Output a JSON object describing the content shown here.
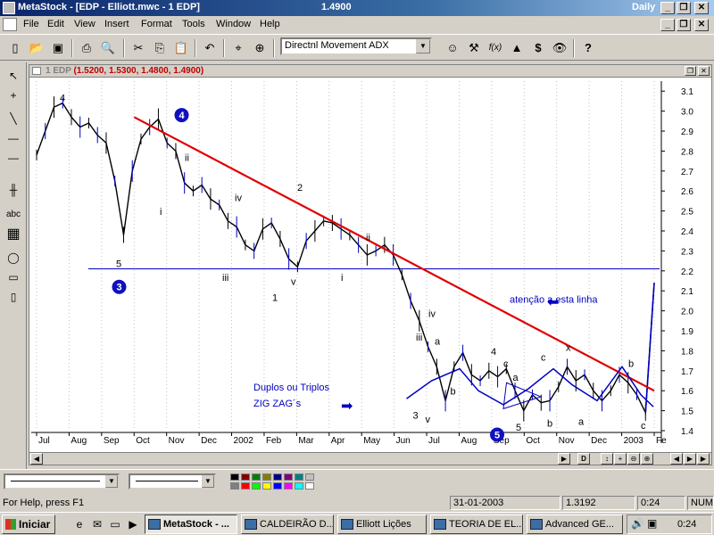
{
  "app": {
    "title": "MetaStock - [EDP - Elliott.mwc - 1 EDP]",
    "price": "1.4900",
    "period": "Daily",
    "minimize": "_",
    "restore": "❐",
    "close": "✕"
  },
  "menu": [
    "File",
    "Edit",
    "View",
    "Insert",
    "Format",
    "Tools",
    "Window",
    "Help"
  ],
  "toolbar": {
    "indicator_select": "Directnl Movement ADX",
    "buttons": [
      {
        "icon": "new-icon",
        "glyph": "▯"
      },
      {
        "icon": "open-icon",
        "glyph": "📂"
      },
      {
        "icon": "save-icon",
        "glyph": "▣"
      },
      {
        "icon": "print-icon",
        "glyph": "⎙"
      },
      {
        "icon": "print-preview-icon",
        "glyph": "🔍"
      },
      {
        "icon": "cut-icon",
        "glyph": "✂"
      },
      {
        "icon": "copy-icon",
        "glyph": "⎘"
      },
      {
        "icon": "paste-icon",
        "glyph": "📋"
      },
      {
        "icon": "undo-icon",
        "glyph": "↶"
      },
      {
        "icon": "crosshair-icon",
        "glyph": "⌖"
      },
      {
        "icon": "zoom-icon",
        "glyph": "⊕"
      }
    ],
    "right_buttons": [
      {
        "icon": "expert-advisor-icon",
        "glyph": "☺"
      },
      {
        "icon": "explorer-icon",
        "glyph": "⚒"
      },
      {
        "icon": "formula-icon",
        "glyph": "f(x)"
      },
      {
        "icon": "system-tester-icon",
        "glyph": "▲"
      },
      {
        "icon": "dollar-icon",
        "glyph": "$"
      },
      {
        "icon": "binoculars-icon",
        "glyph": "👁"
      },
      {
        "icon": "help-icon",
        "glyph": "?"
      }
    ]
  },
  "left_tools": [
    {
      "icon": "pointer-icon",
      "glyph": "↖"
    },
    {
      "icon": "crosshair-tool-icon",
      "glyph": "+"
    },
    {
      "icon": "trendline-icon",
      "glyph": "╲"
    },
    {
      "icon": "horizontal-line-icon",
      "glyph": "—"
    },
    {
      "icon": "horizontal-line-2-icon",
      "glyph": "—"
    },
    {
      "icon": "vertical-line-icon",
      "glyph": "│"
    },
    {
      "icon": "cycle-lines-icon",
      "glyph": "╫"
    },
    {
      "icon": "text-tool-icon",
      "glyph": "abc"
    },
    {
      "icon": "grid-tool-icon",
      "glyph": "▦"
    },
    {
      "icon": "ellipse-icon",
      "glyph": "◯"
    },
    {
      "icon": "rectangle-icon",
      "glyph": "▭"
    },
    {
      "icon": "channel-icon",
      "glyph": "▯"
    }
  ],
  "chart_caption": {
    "symbol": "1 EDP",
    "ohlc": "(1.5200, 1.5300, 1.4800, 1.4900)"
  },
  "chart_data": {
    "type": "line",
    "title": "1 EDP",
    "ylim": [
      1.4,
      3.15
    ],
    "y_ticks": [
      "3.1",
      "3.0",
      "2.9",
      "2.8",
      "2.7",
      "2.6",
      "2.5",
      "2.4",
      "2.3",
      "2.2",
      "2.1",
      "2.0",
      "1.9",
      "1.8",
      "1.7",
      "1.6",
      "1.5",
      "1.4"
    ],
    "x_ticks": [
      "Jul",
      "Aug",
      "Sep",
      "Oct",
      "Nov",
      "Dec",
      "2002",
      "Feb",
      "Mar",
      "Apr",
      "May",
      "Jun",
      "Jul",
      "Aug",
      "Sep",
      "Oct",
      "Nov",
      "Dec",
      "2003",
      "Fe"
    ],
    "series": [
      {
        "values": [
          2.78,
          2.9,
          3.02,
          3.04,
          2.97,
          2.92,
          2.94,
          2.88,
          2.84,
          2.65,
          2.38,
          2.7,
          2.86,
          2.92,
          2.96,
          2.84,
          2.8,
          2.64,
          2.6,
          2.63,
          2.56,
          2.53,
          2.45,
          2.42,
          2.33,
          2.3,
          2.41,
          2.44,
          2.36,
          2.26,
          2.22,
          2.35,
          2.4,
          2.45,
          2.44,
          2.41,
          2.38,
          2.33,
          2.28,
          2.3,
          2.33,
          2.28,
          2.18,
          2.05,
          1.95,
          1.82,
          1.72,
          1.55,
          1.72,
          1.79,
          1.68,
          1.65,
          1.7,
          1.67,
          1.71,
          1.6,
          1.5,
          1.58,
          1.54,
          1.55,
          1.62,
          1.72,
          1.65,
          1.68,
          1.6,
          1.55,
          1.6,
          1.68,
          1.64,
          1.58,
          1.49,
          2.14
        ]
      }
    ],
    "horizontal_line": 2.21,
    "trendline": {
      "from": [
        "Oct",
        2.97
      ],
      "to": [
        "Feb",
        1.6
      ]
    },
    "annotations": [
      {
        "text": "4",
        "kind": "wave"
      },
      {
        "text": "5",
        "kind": "wave"
      },
      {
        "text": "ii",
        "kind": "wave"
      },
      {
        "text": "i",
        "kind": "wave"
      },
      {
        "text": "iv",
        "kind": "wave"
      },
      {
        "text": "2",
        "kind": "wave"
      },
      {
        "text": "iii",
        "kind": "wave"
      },
      {
        "text": "v",
        "kind": "wave"
      },
      {
        "text": "1",
        "kind": "wave"
      },
      {
        "text": "i",
        "kind": "wave"
      },
      {
        "text": "ii",
        "kind": "wave"
      },
      {
        "text": "iv",
        "kind": "wave"
      },
      {
        "text": "iii",
        "kind": "wave"
      },
      {
        "text": "3",
        "kind": "wave"
      },
      {
        "text": "v",
        "kind": "wave"
      },
      {
        "text": "a",
        "kind": "wave"
      },
      {
        "text": "b",
        "kind": "wave"
      },
      {
        "text": "4",
        "kind": "wave"
      },
      {
        "text": "c",
        "kind": "wave"
      },
      {
        "text": "a",
        "kind": "wave"
      },
      {
        "text": "5",
        "kind": "wave"
      },
      {
        "text": "c",
        "kind": "wave"
      },
      {
        "text": "b",
        "kind": "wave"
      },
      {
        "text": "x",
        "kind": "wave"
      },
      {
        "text": "a",
        "kind": "wave"
      },
      {
        "text": "b",
        "kind": "wave"
      },
      {
        "text": "c",
        "kind": "wave"
      },
      {
        "text": "atenção a esta linha",
        "kind": "note"
      },
      {
        "text": "Duplos ou Triplos",
        "kind": "note"
      },
      {
        "text": "ZIG ZAG´s",
        "kind": "note"
      }
    ],
    "circled": [
      "4",
      "3",
      "5"
    ],
    "grid": true,
    "colors": {
      "price": "#000000",
      "trend": "#e00000",
      "blue": "#0000c0",
      "circle": "#1010c0"
    }
  },
  "chart_footer_buttons": [
    "D",
    "↕",
    "+",
    "⊖",
    "⊕"
  ],
  "propbar": {
    "palette": [
      "#000000",
      "#800000",
      "#008000",
      "#808000",
      "#000080",
      "#800080",
      "#008080",
      "#c0c0c0",
      "#808080",
      "#ff0000",
      "#00ff00",
      "#ffff00",
      "#0000ff",
      "#ff00ff",
      "#00ffff",
      "#ffffff"
    ]
  },
  "status": {
    "help": "For Help, press F1",
    "date": "31-01-2003",
    "value": "1.3192",
    "time": "0:24",
    "num": "NUM"
  },
  "taskbar": {
    "start": "Iniciar",
    "tasks": [
      "MetaStock - ...",
      "CALDEIRÃO D...",
      "Elliott Lições",
      "TEORIA DE EL...",
      "Advanced GE..."
    ],
    "clock": "0:24"
  }
}
